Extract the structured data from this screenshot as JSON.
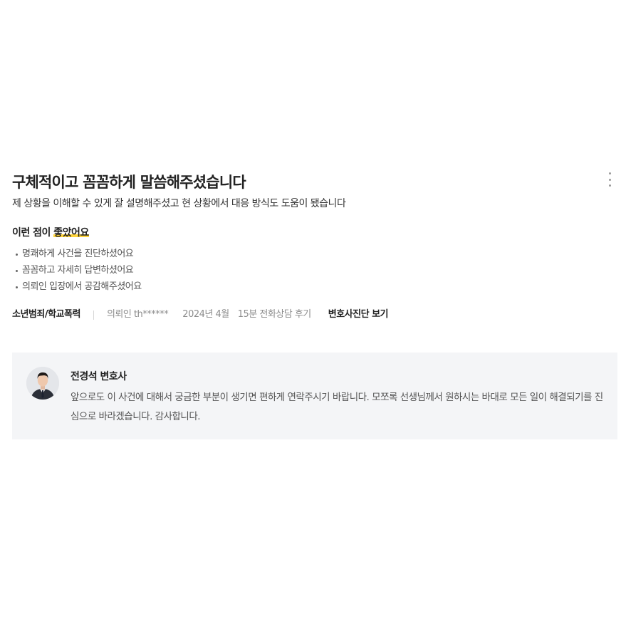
{
  "review": {
    "title": "구체적이고 꼼꼼하게 말씀해주셨습니다",
    "body": "제 상황을 이해할 수 있게 잘 설명해주셨고 현 상황에서 대응 방식도 도움이 됐습니다",
    "good_prefix": "이런 점이 ",
    "good_highlight": "좋았어요",
    "good_points": [
      "명쾌하게 사건을 진단하셨어요",
      "꼼꼼하고 자세히 답변하셨어요",
      "의뢰인 입장에서 공감해주셨어요"
    ],
    "meta": {
      "category": "소년범죄/학교폭력",
      "client": "의뢰인 th******",
      "date": "2024년 4월",
      "consult_type": "15분 전화상담 후기",
      "view_link": "변호사진단 보기"
    }
  },
  "reply": {
    "lawyer_name": "전경석 변호사",
    "text": "앞으로도 이 사건에 대해서 궁금한 부분이 생기면 편하게 연락주시기 바랍니다. 모쪼록 선생님께서 원하시는 바대로 모든 일이 해결되기를 진심으로 바라겠습니다. 감사합니다."
  },
  "icons": {
    "more": "more-vertical-icon",
    "avatar": "lawyer-avatar"
  },
  "colors": {
    "highlight": "#ffd43b",
    "reply_bg": "#f4f5f7"
  }
}
